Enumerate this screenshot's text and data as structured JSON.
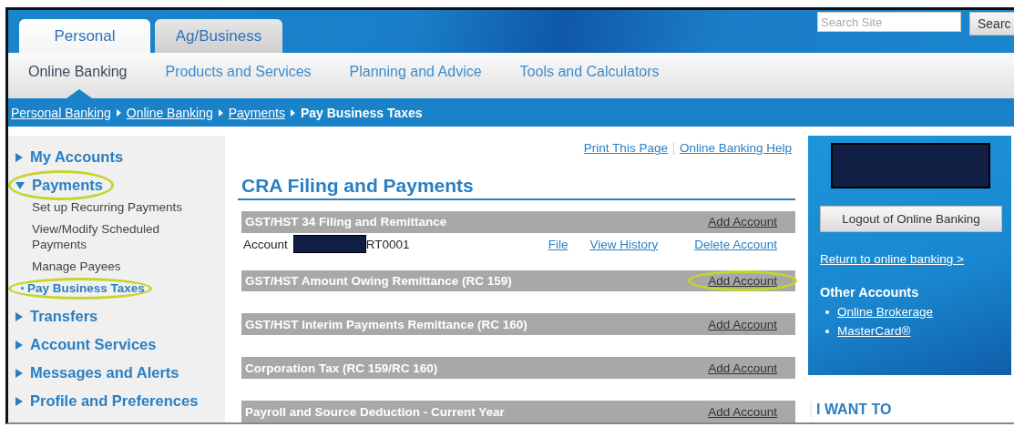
{
  "header": {
    "tabs": [
      {
        "label": "Personal",
        "selected": true
      },
      {
        "label": "Ag/Business",
        "selected": false
      }
    ],
    "search": {
      "placeholder": "Search Site",
      "button": "Searc"
    }
  },
  "nav": [
    {
      "label": "Online Banking",
      "selected": true
    },
    {
      "label": "Products and Services",
      "selected": false
    },
    {
      "label": "Planning and Advice",
      "selected": false
    },
    {
      "label": "Tools and Calculators",
      "selected": false
    }
  ],
  "breadcrumb": [
    {
      "label": "Personal Banking",
      "kind": "link"
    },
    {
      "label": "Online Banking",
      "kind": "link"
    },
    {
      "label": "Payments",
      "kind": "link"
    },
    {
      "label": "Pay Business Taxes",
      "kind": "current"
    }
  ],
  "sidebar": [
    {
      "label": "My Accounts",
      "expanded": false,
      "circled": false
    },
    {
      "label": "Payments",
      "expanded": true,
      "circled": true,
      "children": [
        {
          "label": "Set up Recurring Payments",
          "selected": false,
          "circled": false
        },
        {
          "label": "View/Modify Scheduled Payments",
          "selected": false,
          "circled": false
        },
        {
          "label": "Manage Payees",
          "selected": false,
          "circled": false
        },
        {
          "label": "Pay Business Taxes",
          "selected": true,
          "circled": true
        }
      ]
    },
    {
      "label": "Transfers",
      "expanded": false,
      "circled": false
    },
    {
      "label": "Account Services",
      "expanded": false,
      "circled": false
    },
    {
      "label": "Messages and Alerts",
      "expanded": false,
      "circled": false
    },
    {
      "label": "Profile and Preferences",
      "expanded": false,
      "circled": false
    }
  ],
  "page_links": [
    "Print This Page",
    "Online Banking Help"
  ],
  "title": "CRA Filing and Payments",
  "sections": [
    {
      "title": "GST/HST 34 Filing and Remittance",
      "action": {
        "label": "Add Account",
        "circled": false
      },
      "accounts": [
        {
          "label": "Account",
          "redacted": true,
          "suffix": "RT0001",
          "actions": [
            "File",
            "View History",
            "Delete Account"
          ]
        }
      ]
    },
    {
      "title": "GST/HST Amount Owing Remittance (RC 159)",
      "action": {
        "label": "Add Account",
        "circled": true
      }
    },
    {
      "title": "GST/HST Interim Payments Remittance (RC 160)",
      "action": {
        "label": "Add Account",
        "circled": false
      }
    },
    {
      "title": "Corporation Tax (RC 159/RC 160)",
      "action": {
        "label": "Add Account",
        "circled": false
      }
    },
    {
      "title": "Payroll and Source Deduction - Current Year",
      "action": {
        "label": "Add Account",
        "circled": false
      }
    }
  ],
  "right_panel": {
    "redacted": true,
    "logout": "Logout of Online Banking",
    "return_link": "Return to online banking >",
    "other_accounts": {
      "title": "Other Accounts",
      "links": [
        "Online Brokerage",
        "MasterCard®"
      ]
    }
  },
  "i_want_to": "I WANT TO"
}
